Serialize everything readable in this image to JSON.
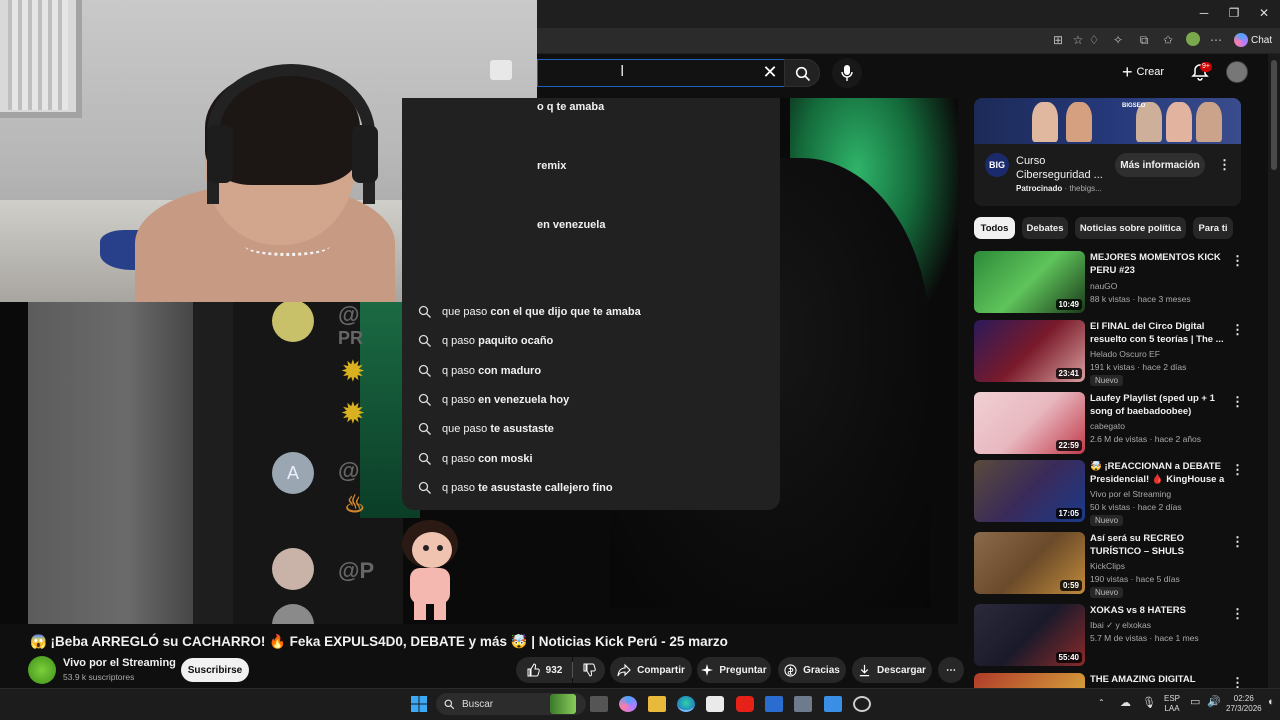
{
  "browser": {
    "chat_label": "Chat"
  },
  "header": {
    "create_label": "Crear",
    "notif_badge": "9+"
  },
  "search": {
    "dropdown_fragments": [
      "o q te amaba",
      "remix",
      "en venezuela"
    ],
    "suggestions": [
      {
        "prefix": "que paso ",
        "suffix": "con el que dijo que te amaba"
      },
      {
        "prefix": "q paso ",
        "suffix": "paquito ocaño"
      },
      {
        "prefix": "q paso ",
        "suffix": "con maduro"
      },
      {
        "prefix": "q paso ",
        "suffix": "en venezuela hoy"
      },
      {
        "prefix": "que paso ",
        "suffix": "te asustaste"
      },
      {
        "prefix": "q paso ",
        "suffix": "con moski"
      },
      {
        "prefix": "q paso ",
        "suffix": "te asustaste callejero fino"
      }
    ]
  },
  "video": {
    "title": "😱 ¡Beba ARREGLÓ su CACHARRO! 🔥 Feka EXPULS4D0, DEBATE y más 🤯 | Noticias Kick Perú - 25 marzo",
    "channel": "Vivo por el Streaming",
    "subscribers": "53.9 k suscriptores",
    "subscribe_label": "Suscribirse",
    "likes": "932",
    "share_label": "Compartir",
    "ask_label": "Preguntar",
    "thanks_label": "Gracias",
    "download_label": "Descargar"
  },
  "ad": {
    "brand_logo": "BIG",
    "banner_text": "BIGSEO",
    "title": "Curso Ciberseguridad ...",
    "sponsored": "Patrocinado",
    "advertiser": "thebigs...",
    "cta": "Más información"
  },
  "chips": [
    "Todos",
    "Debates",
    "Noticias sobre política",
    "Para ti"
  ],
  "recommendations": [
    {
      "title": "MEJORES MOMENTOS KICK PERU #23",
      "channel": "nauGO",
      "stats": "88 k vistas · hace 3 meses",
      "duration": "10:49",
      "new": "",
      "thumb_color": "#2c8a3a"
    },
    {
      "title": "El FINAL del Circo Digital resuelto con 5 teorías | The ...",
      "channel": "Helado Oscuro EF",
      "stats": "191 k vistas · hace 2 días",
      "duration": "23:41",
      "new": "Nuevo",
      "thumb_color": "#7a1a2a"
    },
    {
      "title": "Laufey Playlist (sped up + 1 song of baebadoobee)",
      "channel": "cabegato",
      "stats": "2.6 M de vistas · hace 2 años",
      "duration": "22:59",
      "new": "",
      "thumb_color": "#e8b8bf"
    },
    {
      "title": "🤯 ¡REACCIONAN a DEBATE Presidencial! 🩸 KingHouse a ...",
      "channel": "Vivo por el Streaming",
      "stats": "50 k vistas · hace 2 días",
      "duration": "17:05",
      "new": "Nuevo",
      "thumb_color": "#3a2a5a"
    },
    {
      "title": "Así será su RECREO TURÍSTICO – SHULS",
      "channel": "KickClips",
      "stats": "190 vistas · hace 5 días",
      "duration": "0:59",
      "new": "Nuevo",
      "thumb_color": "#6a4a2a"
    },
    {
      "title": "XOKAS vs 8 HATERS",
      "channel": "Ibai ✓ y elxokas",
      "stats": "5.7 M de vistas · hace 1 mes",
      "duration": "55:40",
      "new": "",
      "thumb_color": "#1a1a2a"
    },
    {
      "title": "THE AMAZING DIGITAL CIRCUS",
      "channel": "",
      "stats": "",
      "duration": "",
      "new": "",
      "thumb_color": "#b03a2a"
    }
  ],
  "taskbar": {
    "search_label": "Buscar",
    "lang": "ESP",
    "lang2": "LAA",
    "time": "02:26",
    "date": "27/3/2026"
  },
  "colors": {
    "accent_red": "#cc0000",
    "search_focus": "#1c62b9",
    "chat_avatar_a": "#9aa6b2"
  }
}
